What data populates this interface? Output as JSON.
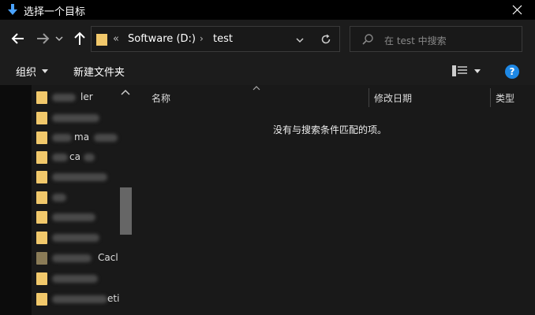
{
  "titlebar": {
    "title": "选择一个目标",
    "close_icon": "close-icon"
  },
  "navbar": {
    "back_icon": "arrow-left-icon",
    "forward_icon": "arrow-right-icon",
    "recent_icon": "chevron-down-icon",
    "up_icon": "arrow-up-icon",
    "address": {
      "overflow": "«",
      "segment1": "Software (D:)",
      "separator": "›",
      "segment2": "test"
    },
    "search_placeholder": "在 test 中搜索"
  },
  "toolbar": {
    "organize": "组织",
    "new_folder": "新建文件夹",
    "help": "?"
  },
  "nav_pane": {
    "items": [
      {
        "label": "",
        "text_right": "ler",
        "folder_style": "yellow"
      },
      {
        "label": "",
        "text_right": "",
        "folder_style": "yellow"
      },
      {
        "label": "",
        "text_right": "ma",
        "folder_style": "yellow"
      },
      {
        "label": "",
        "text_right": "ca",
        "folder_style": "yellow"
      },
      {
        "label": "",
        "text_right": "",
        "folder_style": "yellow"
      },
      {
        "label": "",
        "text_right": "",
        "folder_style": "yellow"
      },
      {
        "label": "",
        "text_right": "",
        "folder_style": "yellow"
      },
      {
        "label": "",
        "text_right": "",
        "folder_style": "yellow"
      },
      {
        "label": "",
        "text_right": "Cacl",
        "folder_style": "dark"
      },
      {
        "label": "",
        "text_right": "",
        "folder_style": "yellow"
      },
      {
        "label": "",
        "text_right": "eti",
        "folder_style": "yellow"
      }
    ]
  },
  "content": {
    "columns": {
      "name": "名称",
      "modified": "修改日期",
      "type": "类型"
    },
    "empty_message": "没有与搜索条件匹配的项。"
  },
  "colors": {
    "accent": "#1e88e5",
    "folder": "#f1c86b",
    "background": "#191919"
  }
}
